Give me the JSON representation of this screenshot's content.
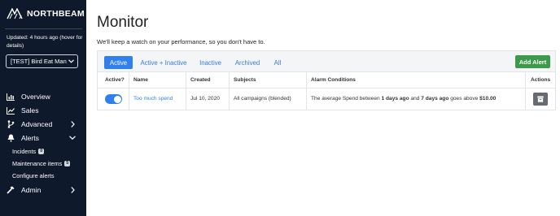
{
  "sidebar": {
    "brand": "NORTHBEAM",
    "updated": "Updated: 4 hours ago (hover for details)",
    "account_select": "[TEST] Bird Eat Man",
    "nav": [
      {
        "label": "Overview",
        "icon": "bar-chart-icon"
      },
      {
        "label": "Sales",
        "icon": "line-chart-icon"
      },
      {
        "label": "Advanced",
        "icon": "branch-icon"
      },
      {
        "label": "Alerts",
        "icon": "bell-icon"
      },
      {
        "label": "Admin",
        "icon": "hammer-icon"
      }
    ],
    "alerts_sub": [
      {
        "label": "Incidents",
        "badge": "0"
      },
      {
        "label": "Maintenance items",
        "badge": "5"
      },
      {
        "label": "Configure alerts"
      }
    ]
  },
  "main": {
    "title": "Monitor",
    "subtitle": "We'll keep a watch on your performance, so you don't have to.",
    "tabs": [
      "Active",
      "Active + Inactive",
      "Inactive",
      "Archived",
      "All"
    ],
    "active_tab": "Active",
    "add_button": "Add Alert",
    "columns": [
      "Active?",
      "Name",
      "Created",
      "Subjects",
      "Alarm Conditions",
      "Actions"
    ],
    "rows": [
      {
        "active": true,
        "name": "Too much spend",
        "created": "Jul 10, 2020",
        "subjects": "All campaigns (blended)",
        "condition": {
          "prefix": "The average Spend between ",
          "start": "1 days ago",
          "mid": " and ",
          "end": "7 days ago",
          "suffix": " goes above ",
          "amount": "$10.00"
        }
      }
    ]
  },
  "colors": {
    "sidebar_bg": "#0e1a2b",
    "accent_blue": "#2f80ed",
    "add_green": "#3c9a4a",
    "delete_gray": "#666b72"
  }
}
